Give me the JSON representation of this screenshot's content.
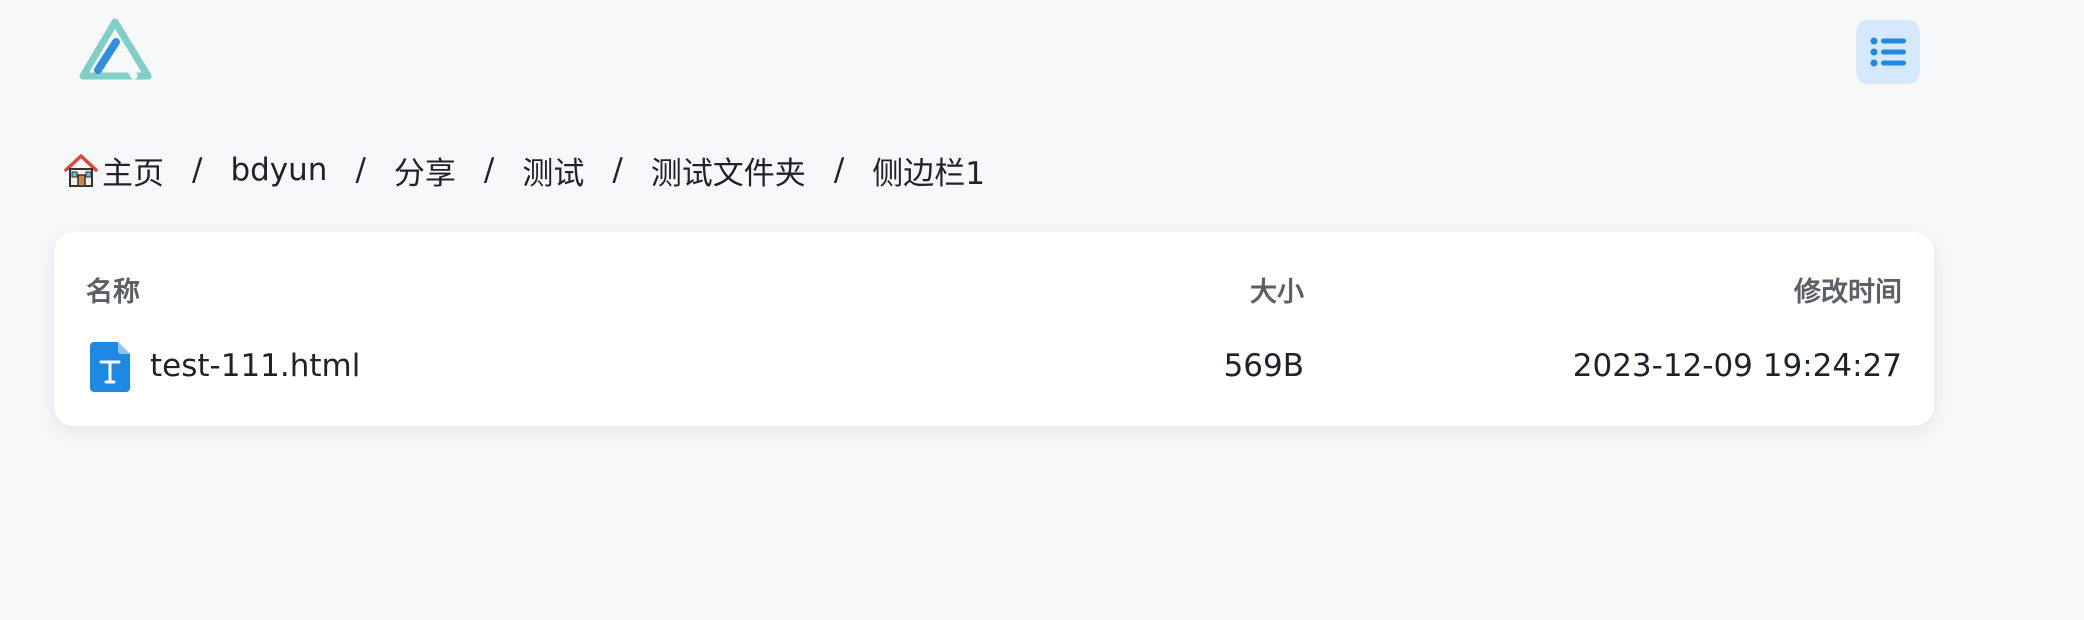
{
  "header": {
    "logo_icon": "app-logo-icon",
    "menu_icon": "list-menu-icon",
    "accent": "#1e88e5",
    "menu_bg": "#d6e8fc"
  },
  "breadcrumb": {
    "items": [
      {
        "label": "主页",
        "icon": "home-icon"
      },
      {
        "label": "bdyun"
      },
      {
        "label": "分享"
      },
      {
        "label": "测试"
      },
      {
        "label": "测试文件夹"
      },
      {
        "label": "侧边栏1"
      }
    ],
    "separator": "/"
  },
  "table": {
    "columns": {
      "name": "名称",
      "size": "大小",
      "modified": "修改时间"
    },
    "rows": [
      {
        "icon": "text-file-icon",
        "name": "test-111.html",
        "size": "569B",
        "modified": "2023-12-09 19:24:27"
      }
    ]
  }
}
